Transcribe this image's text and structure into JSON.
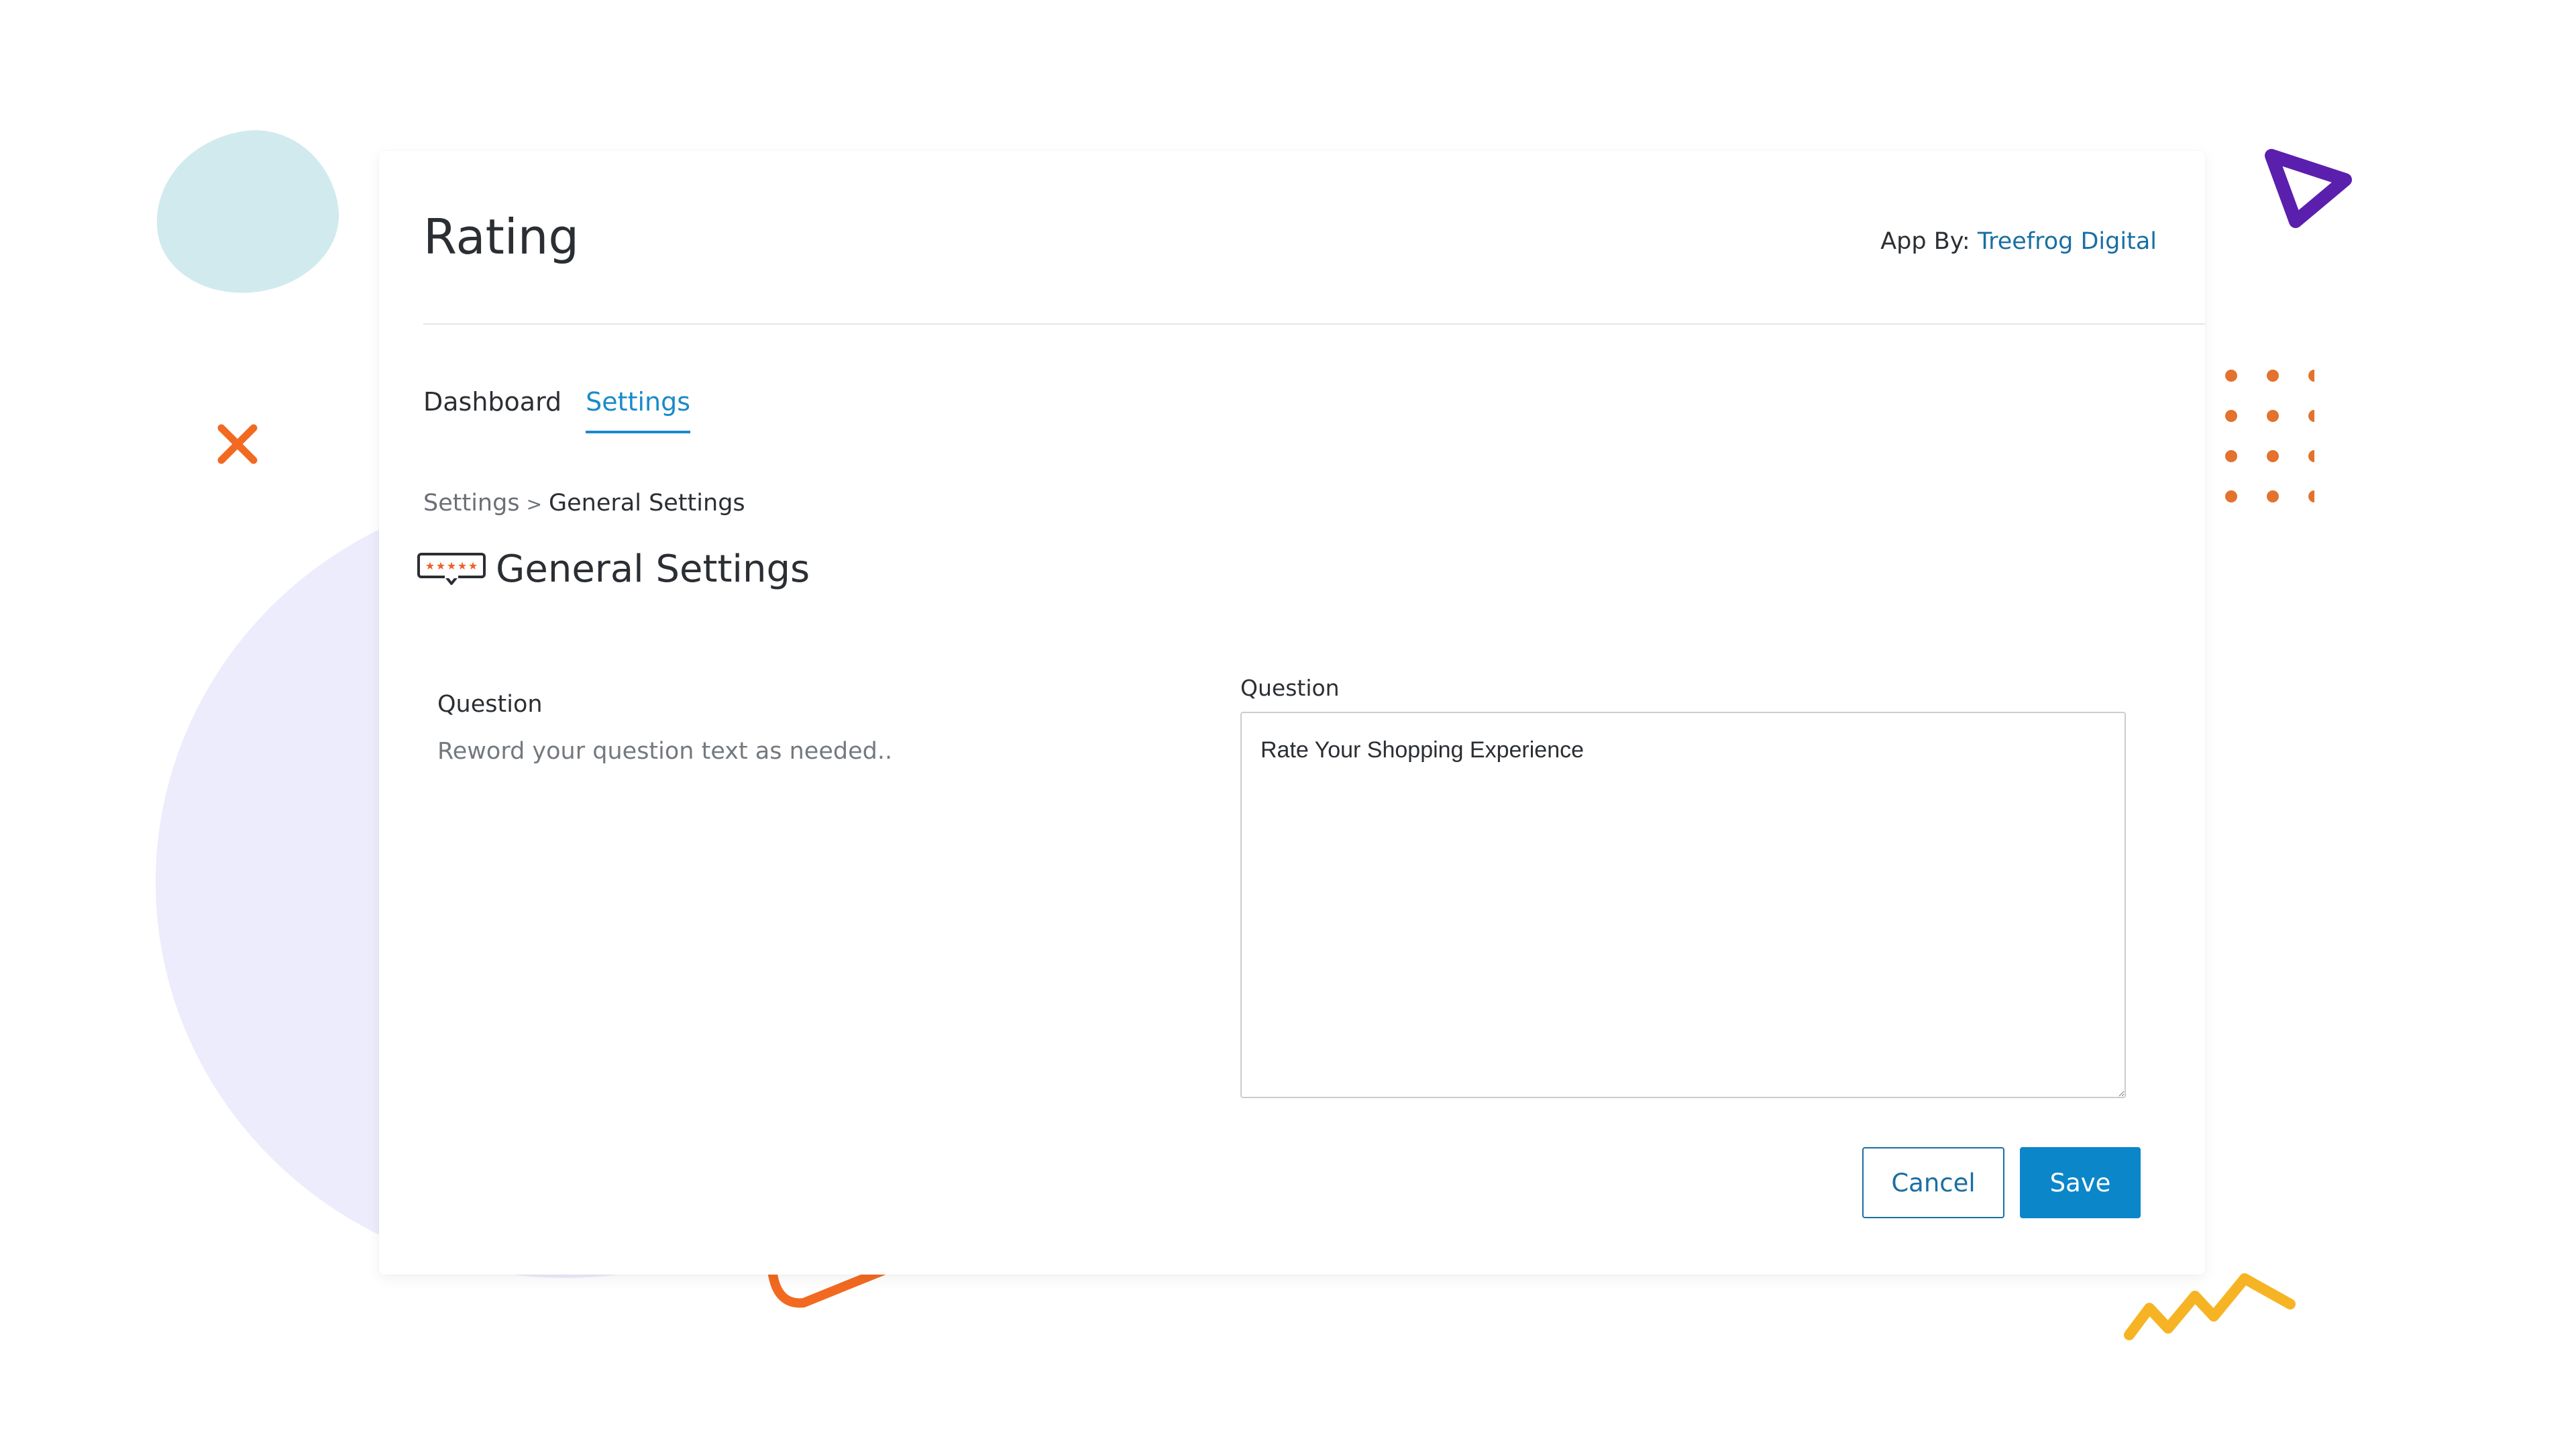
{
  "app": {
    "title": "Rating",
    "app_by_label": "App By:",
    "author": "Treefrog Digital"
  },
  "tabs": [
    {
      "label": "Dashboard",
      "active": false
    },
    {
      "label": "Settings",
      "active": true
    }
  ],
  "breadcrumb": {
    "parent": "Settings",
    "separator": ">",
    "current": "General Settings"
  },
  "section": {
    "title": "General Settings",
    "icon": "rating-stars-icon"
  },
  "question_field": {
    "label": "Question",
    "help_text": "Reword your question text as needed..",
    "input_label": "Question",
    "value": "Rate Your Shopping Experience"
  },
  "actions": {
    "cancel_label": "Cancel",
    "save_label": "Save"
  },
  "colors": {
    "accent": "#0a86c9",
    "link": "#1a6fa3",
    "star_orange": "#e8622a"
  }
}
